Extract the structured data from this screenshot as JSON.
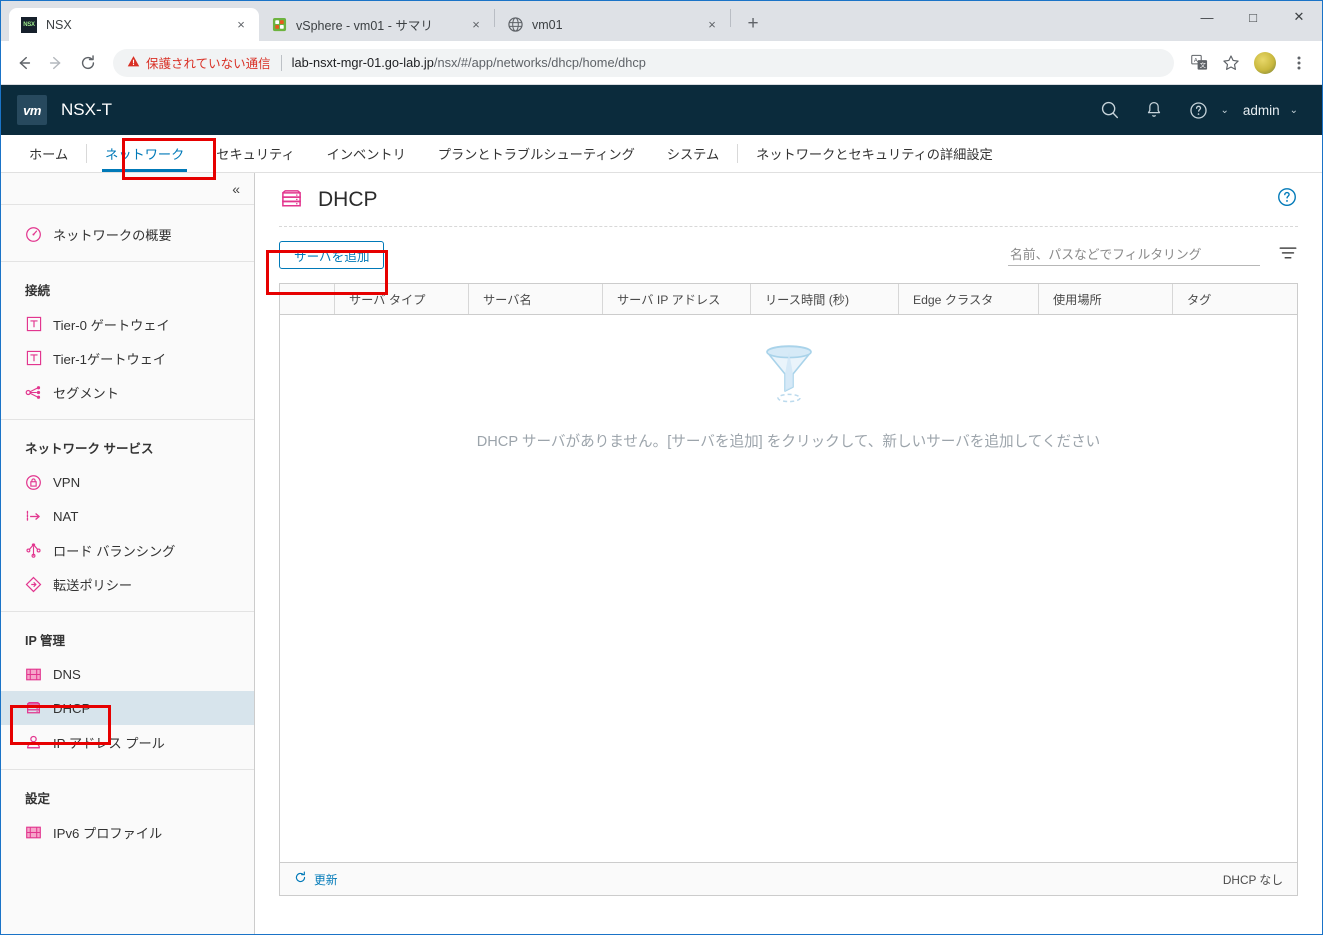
{
  "browser": {
    "tabs": [
      {
        "title": "NSX",
        "favicon": "nsx-favicon",
        "active": true,
        "close_label": "×"
      },
      {
        "title": "vSphere - vm01 - サマリ",
        "favicon": "vsphere-favicon",
        "active": false,
        "close_label": "×"
      },
      {
        "title": "vm01",
        "favicon": "globe-favicon",
        "active": false,
        "close_label": "×"
      }
    ],
    "new_tab_label": "+",
    "window_controls": {
      "minimize": "—",
      "maximize": "□",
      "close": "✕"
    },
    "nav": {
      "back": "←",
      "forward": "→",
      "reload": "⟳"
    },
    "omnibox": {
      "warning_icon": "warning-triangle-icon",
      "warning_text": "保護されていない通信",
      "url_host": "lab-nsxt-mgr-01.go-lab.jp",
      "url_path": "/nsx/#/app/networks/dhcp/home/dhcp"
    },
    "toolbar_icons": [
      "translate-icon",
      "bookmark-star-icon",
      "avatar",
      "more-menu-icon"
    ]
  },
  "nsx": {
    "header": {
      "logo_text": "vm",
      "product": "NSX-T",
      "icons": [
        "search-icon",
        "bell-icon",
        "help-icon",
        "chevron-down-icon"
      ],
      "user": "admin",
      "user_caret": "⌄"
    },
    "tabs": [
      {
        "label": "ホーム",
        "active": false
      },
      {
        "label": "ネットワーク",
        "active": true
      },
      {
        "label": "セキュリティ",
        "active": false
      },
      {
        "label": "インベントリ",
        "active": false
      },
      {
        "label": "プランとトラブルシューティング",
        "active": false
      },
      {
        "label": "システム",
        "active": false
      },
      {
        "label": "ネットワークとセキュリティの詳細設定",
        "active": false
      }
    ],
    "sidebar": {
      "collapse_label": "«",
      "groups": [
        {
          "title": null,
          "items": [
            {
              "label": "ネットワークの概要",
              "icon": "network-overview-icon",
              "selected": false
            }
          ]
        },
        {
          "title": "接続",
          "items": [
            {
              "label": "Tier-0 ゲートウェイ",
              "icon": "tier0-gateway-icon",
              "selected": false
            },
            {
              "label": "Tier-1ゲートウェイ",
              "icon": "tier1-gateway-icon",
              "selected": false
            },
            {
              "label": "セグメント",
              "icon": "segment-icon",
              "selected": false
            }
          ]
        },
        {
          "title": "ネットワーク サービス",
          "items": [
            {
              "label": "VPN",
              "icon": "vpn-icon",
              "selected": false
            },
            {
              "label": "NAT",
              "icon": "nat-icon",
              "selected": false
            },
            {
              "label": "ロード バランシング",
              "icon": "load-balancing-icon",
              "selected": false
            },
            {
              "label": "転送ポリシー",
              "icon": "forwarding-policy-icon",
              "selected": false
            }
          ]
        },
        {
          "title": "IP 管理",
          "items": [
            {
              "label": "DNS",
              "icon": "dns-icon",
              "selected": false
            },
            {
              "label": "DHCP",
              "icon": "dhcp-icon",
              "selected": true
            },
            {
              "label": "IP アドレス プール",
              "icon": "ip-address-pool-icon",
              "selected": false
            }
          ]
        },
        {
          "title": "設定",
          "items": [
            {
              "label": "IPv6 プロファイル",
              "icon": "ipv6-profile-icon",
              "selected": false
            }
          ]
        }
      ]
    },
    "page": {
      "title": "DHCP",
      "title_icon": "dhcp-server-icon",
      "help_icon": "help-circle-icon",
      "add_server_button": "サーバを追加",
      "filter_placeholder": "名前、パスなどでフィルタリング",
      "filter_value": "",
      "filter_icon": "filter-icon",
      "columns": [
        {
          "label": ""
        },
        {
          "label": "サーバ タイプ"
        },
        {
          "label": "サーバ名"
        },
        {
          "label": "サーバ IP アドレス"
        },
        {
          "label": "リース時間 (秒)"
        },
        {
          "label": "Edge クラスタ"
        },
        {
          "label": "使用場所"
        },
        {
          "label": "タグ"
        }
      ],
      "rows": [],
      "empty_icon": "empty-funnel-icon",
      "empty_message": "DHCP サーバがありません。[サーバを追加] をクリックして、新しいサーバを追加してください",
      "refresh_label": "更新",
      "refresh_icon": "refresh-icon",
      "count_text": "DHCP なし"
    }
  },
  "colors": {
    "nsx_header_bg": "#0b2b3c",
    "accent_blue": "#0079b8",
    "sidebar_icon_pink": "#e2368f",
    "annotation_red": "#e60000",
    "selected_item_bg": "#d7e4ec"
  }
}
